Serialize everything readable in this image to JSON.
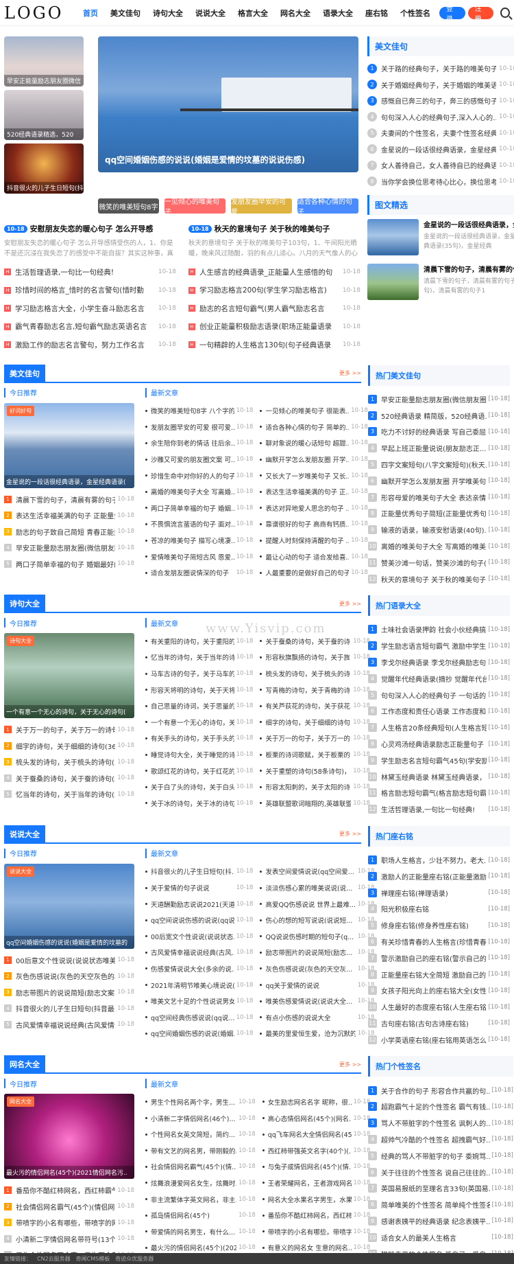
{
  "header": {
    "logo": "LOGO",
    "nav": [
      "首页",
      "美文佳句",
      "诗句大全",
      "说说大全",
      "格言大全",
      "网名大全",
      "语录大全",
      "座右铭",
      "个性签名"
    ],
    "login": "登录",
    "register": "注册"
  },
  "thumbs": [
    "早安正能量励志朋友圈微信",
    "520经典语录精选，520",
    "抖音很火的儿子生日短句(抖"
  ],
  "banner": "qq空间婚姻伤感的说说(婚姻是爱情的坟墓的说说伤感)",
  "tags": [
    "微笑的唯美短句8字",
    "一见倾心的唯美句子",
    "发朋友圈早安的可爱",
    "适合各种心情的句子"
  ],
  "hot": [
    {
      "date": "10-18",
      "title": "安慰朋友失恋的暖心句子 怎么开导感",
      "desc": "安慰朋友失恋的暖心句子 怎么开导感情受伤的人，1、你是不是还沉浸在我失恋了的感受中不能自拔？其实这种事，真的没什"
    },
    {
      "date": "10-18",
      "title": "秋天的意境句子 关于秋的唯美句子",
      "desc": "秋天的意境句子 关于秋的唯美句子103句，1、午间阳光晒暖，晚来风过随酣，羽的有点儿适心。八月的天气像人的心情。总是"
    }
  ],
  "hotlist": [
    [
      "生活哲理语录,一句比一句经典!",
      "10-18",
      "人生感言的经典语录_正能量人生感悟的句",
      "10-18"
    ],
    [
      "珍惜时间的格言_惜时的名言警句(惜时勤",
      "10-18",
      "学习励志格言200句(学生学习励志格言)",
      "10-18"
    ],
    [
      "学习励志格言大全，小学生奋斗励志名言",
      "10-18",
      "励志的名言短句霸气(男人霸气励志名言",
      "10-18"
    ],
    [
      "霸气青春励志名言,短句霸气励志英语名言",
      "10-18",
      "创业正能量积极励志语录(职场正能量语录",
      "10-18"
    ],
    [
      "激励工作的励志名言警句，努力工作名言",
      "10-18",
      "一句精辟的人生格言130句(句子经典语录",
      "10-18"
    ]
  ],
  "sideA": {
    "title": "美文佳句",
    "items": [
      [
        "关于路的经典句子，关于路的唯美句子(",
        "10-18"
      ],
      [
        "关于婚姻经典句子，关于婚姻的唯美语...",
        "10-18"
      ],
      [
        "感慨自已奔三的句子，奔三的感慨句子(",
        "10-18"
      ],
      [
        "句句深入人心的经典句子,深入人心的...",
        "10-18"
      ],
      [
        "夫妻间的个性签名，夫妻个性签名经典...",
        "10-18"
      ],
      [
        "金星说的一段话很经典语录，金星经典...",
        "10-18"
      ],
      [
        "女人善待自己，女人善待自已的经典语...",
        "10-18"
      ],
      [
        "当你学会换位思考待心比心，换位思考...",
        "10-18"
      ]
    ]
  },
  "sideB": {
    "title": "图文精选",
    "items": [
      {
        "title": "金星说的一段话很经典语录，金...",
        "desc": "金星说的一段话很经典语录，金星经典语录(35句)，金星经典"
      },
      {
        "title": "清晨下雪的句子，清晨有雾的句子",
        "desc": "清晨下雪的句子，清晨有雾的句子(40句)，清晨有雾的句子1"
      }
    ]
  },
  "more": "更多 >>",
  "today": "今日推荐",
  "latest": "最新文章",
  "sections": [
    {
      "label": "美文佳句",
      "badge": "好词好句",
      "cap": "金星说的一段话很经典语录，金星经典语录(",
      "list": [
        [
          "清晨下雪的句子，清晨有雾的句子(",
          "10-18"
        ],
        [
          "表达生活幸福美满的句子 正能量生...",
          "10-18"
        ],
        [
          "励志的句子致自己简短 青春正能量...",
          "10-18"
        ],
        [
          "早安正能量励志朋友圈(微信朋友圈...",
          "10-18"
        ],
        [
          "两口子简单幸福的句子 婚姻最好的...",
          "10-18"
        ]
      ],
      "grid": [
        "微笑的唯美短句8字 八个字的...",
        "一见倾心的唯美句子 很能表...",
        "发朋友圈早安的可爱 很可爱...",
        "适合各种心情的句子 简单的...",
        "余生陪你到老的情话 往后余...",
        "聊对象说的暖心话短句 超甜...",
        "沙雕又可爱的朋友圈文案 可...",
        "幽默开学怎么发朋友圈 开学...",
        "珍惜生命中对你好的人的句子...",
        "又长大了一岁唯美句子 又长...",
        "离婚的唯美句子大全 写离婚...",
        "表达生活幸福美满的句子 正...",
        "两口子简单幸福的句子 婚姻...",
        "表达对异地爱人思念的句子 ...",
        "不畏惧流言蜚语的句子 面对...",
        "靠谱很好的句子 高商有钙质...",
        "苍凉的唯美句子 描写心境凄...",
        "提醒人时刻保持清醒的句子 ...",
        "爱情唯美句子简短古风 恩爱...",
        "最让心动的句子 适合发给喜...",
        "适合发朋友圈说情深的句子",
        "人最重要的是做好自己的句子..."
      ]
    },
    {
      "label": "诗句大全",
      "badge": "诗句大全",
      "cap": "一个有意一个无心的诗句，关于无心的诗句(",
      "list": [
        [
          "关于万一的句子，关于万一的诗句(",
          "10-18"
        ],
        [
          "细字的诗句，关于细细的诗句(36句)",
          "10-18"
        ],
        [
          "梳头发的诗句，关于梳头的诗句(3...",
          "10-18"
        ],
        [
          "关于蚕桑的诗句，关于蚕的诗句(20...",
          "10-18"
        ],
        [
          "忆当年的诗句，关于当年的诗句(20...",
          "10-18"
        ]
      ],
      "grid": [
        "有关重阳的诗句，关于重阳的...",
        "关于蚕桑的诗句，关于蚕的诗...",
        "忆当年的诗句，关于当年的诗...",
        "形容秋旗飘扬的诗句，关于旌...",
        "马车古诗的句子，关于马车的...",
        "梳头发的诗句，关于梳头的诗...",
        "形容天将明的诗句，关于天将...",
        "写青梅的诗句，关于青梅的诗...",
        "自己思量的诗词，关于思量的...",
        "有关芦荻花的诗句，关于获花...",
        "一个有意一个无心的诗句，关...",
        "细字的诗句，关于细细的诗句...",
        "有关手头的诗句，关于手头的...",
        "关于万一的句子，关于万一的...",
        "睡觉诗句大全，关于睡觉的诗...",
        "板栗的诗词歌赋，关于板栗的...",
        "歌颂红花的诗句，关于红花的...",
        "关于重塑的诗句(58条诗句)，...",
        "关于白了头的诗句，关于白头...",
        "形容太阳刺的，关于太阳的诗...",
        "关于冰的诗句，关于冰的诗句(",
        "英雄联盟歌词暗翔的,英雄联盟..."
      ]
    },
    {
      "label": "说说大全",
      "badge": "说说大全",
      "cap": "qq空间婚姻伤感的说说(婚姻是爱情的坟墓的",
      "list": [
        [
          "00后意文个性说说(说说状态唯美的",
          "10-18"
        ],
        [
          "灰色伤感说说(灰色的天空灰色的心...",
          "10-18"
        ],
        [
          "励志带图片的说说简短(励志文案简...",
          "10-18"
        ],
        [
          "抖音很火的儿子生日短句(抖音最火...",
          "10-18"
        ],
        [
          "古风爱情幸福说说经典(古风爱情说...",
          "10-18"
        ]
      ],
      "grid": [
        "抖音很火的儿子生日短句(抖...",
        "发表空间爱情说说(qq空间爱...",
        "关于爱情的句子说说",
        "淡淡伤感心累的唯美说说(说...",
        "天道酬勤励志说说2021(天道...",
        "高爱QQ伤感说说 世界上最难...",
        "qq空间说说伤感的说说(qq说...",
        "伤心的想的短写说说(说说短...",
        "00后宽文个性说说(说说状态...",
        "QQ说说伤感时期的短句子(q...",
        "古风爱情幸福说说经典(古风...",
        "励志带图片的说说简短(励志...",
        "伤感爱情说说大全(多余的说...",
        "灰色伤感说说(灰色的天空灰...",
        "2021年清明节唯美心境说说(...",
        "qq关于爱情的说说",
        "唯美文艺十足的个性说说男女...",
        "唯美伤感爱情说说(说说大全...",
        "qq空间经典伤感说说(qq说...",
        "有点小伤感的说说大全",
        "qq空间婚姻伤感的说说(婚姻...",
        "最美的里爱恒生爱，沧为沉默的..."
      ]
    },
    {
      "label": "网名大全",
      "badge": "网名大全",
      "cap": "最火污的情侣网名(45个)(2021情侣网名污..",
      "list": [
        [
          "番茄你不酷红柿网名，西红柿霸气...",
          "10-18"
        ],
        [
          "社会情侣网名霸气(45个)(情侣网名...",
          "10-18"
        ],
        [
          "带喷字的小名有哪些，带喷字的网...",
          "10-18"
        ],
        [
          "小清新二字情侣网名带符号(13个)(...",
          "10-18"
        ],
        [
          "男生个性网名两个字，男生两个字...",
          "10-18"
        ]
      ],
      "grid": [
        "男生个性网名两个字，男生...",
        "女生励志网名名字 昵称，很...",
        "小清新二字情侣网名(46个)...",
        "高心态情侣网名(45个)(网名...",
        "个性网名女英文简短，简约...",
        "qq飞车网名大全情侣网名(45...",
        "带有文艺的网名男，带刚毅的...",
        "西红柿带强英文名字(40个)(...",
        "社会情侣网名霸气(45个)(情...",
        "与兔子或情侣网名(45个)(情...",
        "炫舞浪漫爱网名女生，炫舞时...",
        "王者荣耀网名，王者游戏网名...",
        "非主流繁体字英文网名，非主...",
        "网名大全水果名字男生，水果...",
        "孤岛情侣网名(45个)",
        "番茄你不酷红柿网名，西红柿...",
        "带爱情的网名男生，有什么...",
        "带喷字的小名有哪些，带喷字...",
        "最火污的情侣网名(45个)(202...",
        "有意义的网名女 生意的网名...",
        "小清新二字情侣网名带符号(1...",
        "寓字开头的网名两个字女生，..."
      ]
    }
  ],
  "sides": [
    {
      "title": "热门美文佳句",
      "items": [
        "早安正能量励志朋友圈(微信朋友圈...",
        "520经典语录 精简版，520经典语...",
        "吃力不讨好的经典语录 写自己委屈...",
        "早起上班正能量说说(朋友励志正...",
        "四字文案短句(八字文案短句)(秋天...",
        "幽默开学怎么发朋友圈 开学唯美句...",
        "形容母爱的唯美句子大全 表达亲情...",
        "正能量优秀句子简短(正能量优秀句...",
        "输液的语录，输液安慰语录(40句)...",
        "离婚的唯美句子大全 写离婚的唯美...",
        "赞美沙滩一句话，赞美沙滩的句子(...",
        "秋天的意境句子 关于秋的唯美句子..."
      ]
    },
    {
      "title": "热门语录大全",
      "items": [
        "土味社会语录押韵 社会小伙经典搞...",
        "学生励志语言短句霸气 激励中学生...",
        "李戈尔经典语录 李戈尔经典励志句子",
        "觉醒年代经典语录(摘抄 觉醒年代台...",
        "句句深入人心的经典句子 一句话的...",
        "工作态度和责任心语录 工作态度和...",
        "人生格言20条经典短句(人生格言短...",
        "心灵鸡汤经典语录励志正能量句子 ...",
        "学生励志名言短句霸气45句(学安励...",
        "林黛玉经典语录 林黛玉经典语录，...",
        "格言励志短句霸气(格言励志短句霸...",
        "生活哲理语录,一句比一句经典!"
      ]
    },
    {
      "title": "热门座右铭",
      "items": [
        "职场人生格言，少壮不努力，老大...",
        "激励人的正能量座右铭(正能量激励...",
        "禅理座右铭(禅理语录)",
        "阳光积极座右铭",
        "修身座右铭(修身养性座右铭)",
        "有关珍惜青春的人生格言(珍惜青春...",
        "警示激励自己的座右铭(警示自己的...",
        "正能量座右铭大全简短 激励自己的...",
        "女孩子阳光向上的座右铭大全(女性...",
        "人生最好的态度座右铭(人生座右铭...",
        "古句座右铭(古句古诗座右铭)",
        "小学英语座右铭(座右铭用英语怎么..."
      ]
    },
    {
      "title": "热门个性签名",
      "items": [
        "关于合作的句子 形容合作共赢的句...",
        "超跑霸气十足的个性签名 霸气有钱...",
        "骂人不带脏字的个性签名 讽刺人的...",
        "超帅气冷酷的个性签名 超拽霸气好...",
        "经典的骂人不带脏字的句子 委婉骂...",
        "关于往往的个性签名 说自己往往的...",
        "英国易报纸的至理名言33句(英国易...",
        "简单唯美的个性签名 简单纯个性签名...",
        "感谢表姨平的经典语录 纪念表姨平...",
        "适合女人的最美人生格言",
        "猫咪走平的个性签名 爱自己，爱自...",
        "坦然放下的个性签名 豁然放下放下..."
      ]
    }
  ],
  "footer": [
    "友情链接：",
    "CN2云服务器",
    "奇闻CMS模板",
    "奇迹众优服务器"
  ],
  "watermark": "www.Yisvip.com"
}
